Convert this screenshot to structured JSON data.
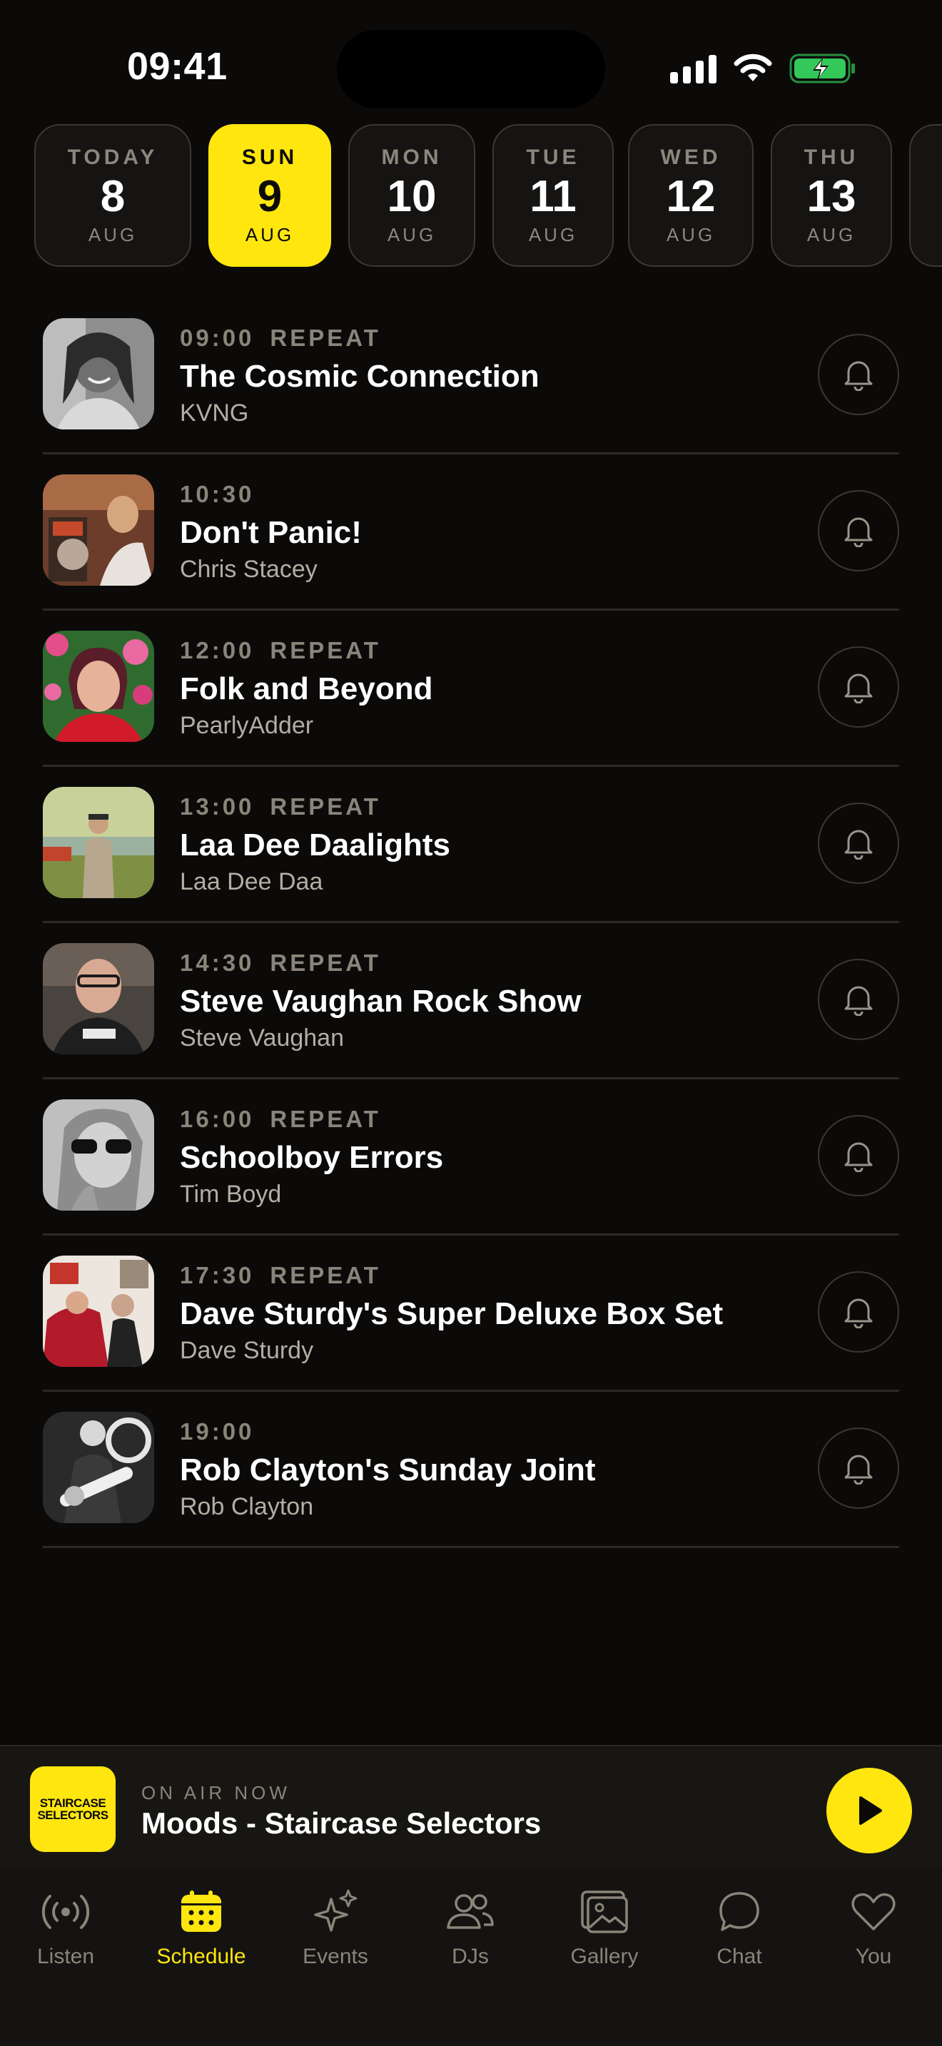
{
  "status_bar": {
    "time": "09:41"
  },
  "dates": [
    {
      "dow": "TODAY",
      "day": "8",
      "month": "AUG",
      "selected": false
    },
    {
      "dow": "SUN",
      "day": "9",
      "month": "AUG",
      "selected": true
    },
    {
      "dow": "MON",
      "day": "10",
      "month": "AUG",
      "selected": false
    },
    {
      "dow": "TUE",
      "day": "11",
      "month": "AUG",
      "selected": false
    },
    {
      "dow": "WED",
      "day": "12",
      "month": "AUG",
      "selected": false
    },
    {
      "dow": "THU",
      "day": "13",
      "month": "AUG",
      "selected": false
    }
  ],
  "shows": [
    {
      "time": "09:00",
      "repeat": "REPEAT",
      "title": "The Cosmic Connection",
      "host": "KVNG"
    },
    {
      "time": "10:30",
      "repeat": "",
      "title": "Don't Panic!",
      "host": "Chris Stacey"
    },
    {
      "time": "12:00",
      "repeat": "REPEAT",
      "title": "Folk and Beyond",
      "host": "PearlyAdder"
    },
    {
      "time": "13:00",
      "repeat": "REPEAT",
      "title": "Laa Dee Daalights",
      "host": "Laa Dee Daa"
    },
    {
      "time": "14:30",
      "repeat": "REPEAT",
      "title": "Steve Vaughan Rock Show",
      "host": "Steve Vaughan"
    },
    {
      "time": "16:00",
      "repeat": "REPEAT",
      "title": "Schoolboy Errors",
      "host": "Tim Boyd"
    },
    {
      "time": "17:30",
      "repeat": "REPEAT",
      "title": "Dave Sturdy's Super Deluxe Box Set",
      "host": "Dave Sturdy"
    },
    {
      "time": "19:00",
      "repeat": "",
      "title": "Rob Clayton's Sunday Joint",
      "host": "Rob Clayton"
    }
  ],
  "now_playing": {
    "logo_line1": "STAIRCASE",
    "logo_line2": "SELECTORS",
    "label": "ON AIR NOW",
    "title": "Moods - Staircase Selectors"
  },
  "tabs": [
    {
      "label": "Listen",
      "icon": "broadcast-icon",
      "active": false
    },
    {
      "label": "Schedule",
      "icon": "calendar-icon",
      "active": true
    },
    {
      "label": "Events",
      "icon": "sparkles-icon",
      "active": false
    },
    {
      "label": "DJs",
      "icon": "people-icon",
      "active": false
    },
    {
      "label": "Gallery",
      "icon": "photos-icon",
      "active": false
    },
    {
      "label": "Chat",
      "icon": "chat-bubble-icon",
      "active": false
    },
    {
      "label": "You",
      "icon": "heart-icon",
      "active": false
    }
  ],
  "colors": {
    "accent": "#ffe60f",
    "background": "#0b0a09",
    "muted": "#8a847a",
    "battery": "#34c759"
  }
}
